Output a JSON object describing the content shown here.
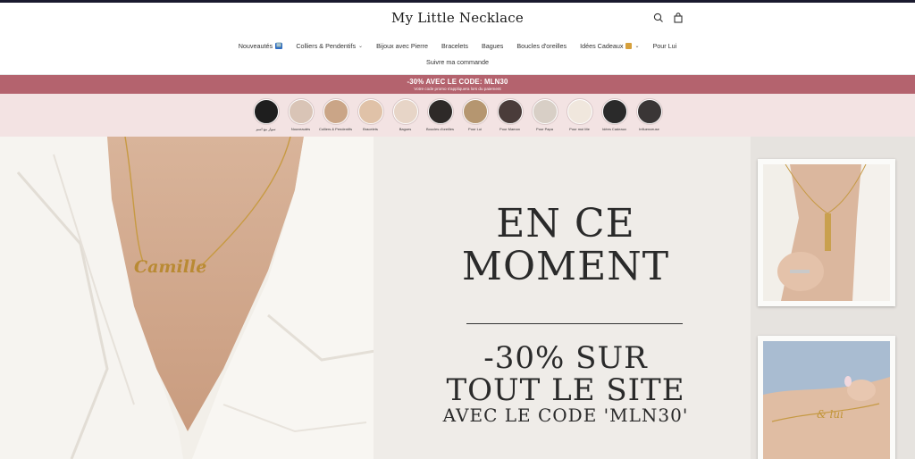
{
  "brand": "My Little Necklace",
  "header": {
    "search_icon": "search-icon",
    "cart_icon": "shopping-bag-icon"
  },
  "nav": {
    "items": [
      {
        "label": "Nouveautés",
        "badge": "🆕"
      },
      {
        "label": "Colliers & Pendentifs",
        "dropdown": true
      },
      {
        "label": "Bijoux avec Pierre"
      },
      {
        "label": "Bracelets"
      },
      {
        "label": "Bagues"
      },
      {
        "label": "Boucles d'oreilles"
      },
      {
        "label": "Idées Cadeaux",
        "gift": true,
        "dropdown": true
      },
      {
        "label": "Pour Lui"
      }
    ],
    "second_row": "Suivre ma commande"
  },
  "promo": {
    "main": "-30% AVEC LE CODE: MLN30",
    "sub": "Votre code promo s'appliquera lors du paiement",
    "color": "#b4636e"
  },
  "categories": [
    {
      "label": "سوار مع اسم",
      "color": "#1e1e1e"
    },
    {
      "label": "Nouveautés",
      "color": "#d9c4b6"
    },
    {
      "label": "Colliers & Pendentifs",
      "color": "#caa587"
    },
    {
      "label": "Bracelets",
      "color": "#e0c2a8"
    },
    {
      "label": "Bagues",
      "color": "#e7d5c7"
    },
    {
      "label": "Boucles d'oreilles",
      "color": "#2e2a28"
    },
    {
      "label": "Pour Lui",
      "color": "#b59670"
    },
    {
      "label": "Pour Maman",
      "color": "#4a3c3a"
    },
    {
      "label": "Pour Papa",
      "color": "#d8cfc6"
    },
    {
      "label": "Pour moi Me",
      "color": "#f0e7dd"
    },
    {
      "label": "Idées Cadeaux",
      "color": "#2a2a2a"
    },
    {
      "label": "Influenceuse",
      "color": "#3a3636"
    }
  ],
  "hero": {
    "line1": "EN CE",
    "line2": "MOMENT",
    "line3": "-30% SUR",
    "line4": "TOUT LE SITE",
    "line5": "AVEC LE CODE 'MLN30'",
    "necklace_name": "Camille"
  }
}
